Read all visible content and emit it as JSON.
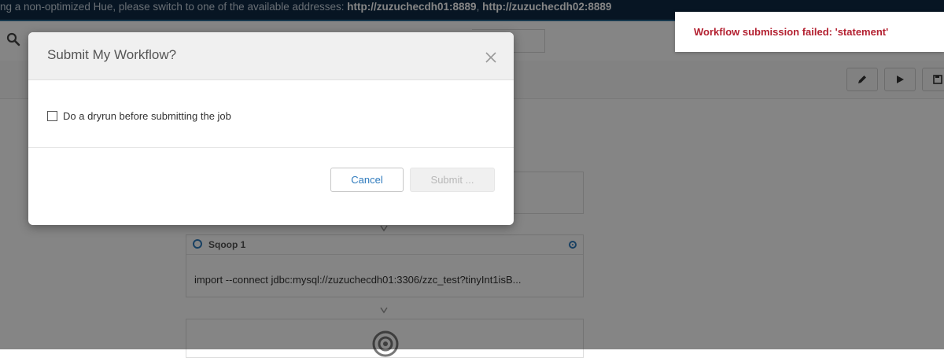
{
  "banner": {
    "text_prefix": "ng a non-optimized Hue, please switch to one of the available addresses: ",
    "address_1": "http://zuzuchecdh01:8889",
    "separator": ", ",
    "address_2": "http://zuzuchecdh02:8889"
  },
  "toast": {
    "message": "Workflow submission failed: 'statement'"
  },
  "modal": {
    "title": "Submit My Workflow?",
    "dryrun_label": "Do a dryrun before submitting the job",
    "dryrun_checked": false,
    "cancel_label": "Cancel",
    "submit_label": "Submit ..."
  },
  "workflow": {
    "nodes": [
      {
        "name": "Sqoop 1",
        "command": "import --connect jdbc:mysql://zuzuchecdh01:3306/zzc_test?tinyInt1isB..."
      }
    ]
  },
  "icons": {
    "search": "search-icon",
    "edit": "pencil-icon",
    "run": "play-icon",
    "save": "save-icon",
    "close": "close-icon",
    "node_type": "circle-icon",
    "node_remove": "target-icon",
    "end": "end-node-icon"
  },
  "colors": {
    "banner_bg": "#0f2a44",
    "accent": "#2f7bbd",
    "error": "#b32030"
  }
}
